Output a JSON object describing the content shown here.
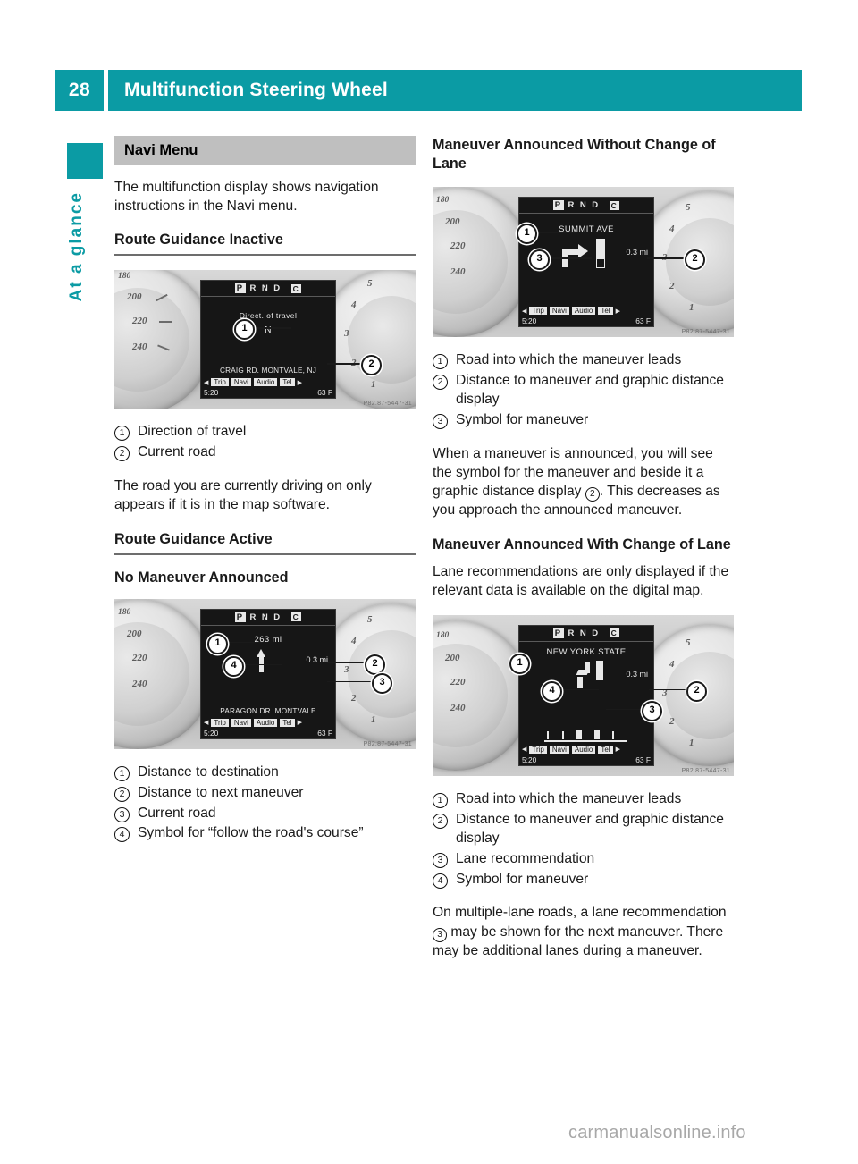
{
  "header": {
    "page_number": "28",
    "title": "Multifunction Steering Wheel",
    "accent_color": "#0b9ba4"
  },
  "side_tab": {
    "label": "At a glance"
  },
  "left_column": {
    "banner": "Navi Menu",
    "intro": "The multifunction display shows navigation instructions in the Navi menu.",
    "section_inactive": "Route Guidance Inactive",
    "figure_inactive": {
      "prnd": [
        "P",
        "R",
        "N",
        "D"
      ],
      "gear_indicator": "C",
      "line1": "Direct. of travel",
      "line2": "N",
      "road": "CRAIG RD. MONTVALE, NJ",
      "menu": [
        "Trip",
        "Navi",
        "Audio",
        "Tel"
      ],
      "selected_menu": "Navi",
      "time": "5:20",
      "temperature": "63 F",
      "photo_id": "P82.87-5447-31",
      "callouts": [
        "1",
        "2"
      ],
      "speedo_numbers": [
        "180",
        "200",
        "220",
        "240"
      ],
      "tacho_numbers": [
        "1",
        "2",
        "3",
        "4",
        "5"
      ]
    },
    "legend_inactive": [
      {
        "num": "1",
        "text": "Direction of travel"
      },
      {
        "num": "2",
        "text": "Current road"
      }
    ],
    "note_inactive": "The road you are currently driving on only appears if it is in the map software.",
    "section_active": "Route Guidance Active",
    "subsection_no_maneuver": "No Maneuver Announced",
    "figure_no_maneuver": {
      "prnd": [
        "P",
        "R",
        "N",
        "D"
      ],
      "gear_indicator": "C",
      "distance_to_destination": "263 mi",
      "distance_to_maneuver": "0.3 mi",
      "road": "PARAGON DR. MONTVALE",
      "menu": [
        "Trip",
        "Navi",
        "Audio",
        "Tel"
      ],
      "selected_menu": "Navi",
      "time": "5:20",
      "temperature": "63 F",
      "photo_id": "P82.87-5447-31",
      "callouts": [
        "1",
        "2",
        "3",
        "4"
      ]
    },
    "legend_no_maneuver": [
      {
        "num": "1",
        "text": "Distance to destination"
      },
      {
        "num": "2",
        "text": "Distance to next maneuver"
      },
      {
        "num": "3",
        "text": "Current road"
      },
      {
        "num": "4",
        "text": "Symbol for “follow the road's course”"
      }
    ]
  },
  "right_column": {
    "section_without_lane": "Maneuver Announced Without Change of Lane",
    "figure_without_lane": {
      "prnd": [
        "P",
        "R",
        "N",
        "D"
      ],
      "gear_indicator": "C",
      "road_into": "SUMMIT AVE",
      "distance_to_maneuver": "0.3 mi",
      "menu": [
        "Trip",
        "Navi",
        "Audio",
        "Tel"
      ],
      "selected_menu": "Navi",
      "time": "5:20",
      "temperature": "63 F",
      "photo_id": "P82.87-5447-31",
      "callouts": [
        "1",
        "2",
        "3"
      ]
    },
    "legend_without_lane": [
      {
        "num": "1",
        "text": "Road into which the maneuver leads"
      },
      {
        "num": "2",
        "text": "Distance to maneuver and graphic distance display"
      },
      {
        "num": "3",
        "text": "Symbol for maneuver"
      }
    ],
    "note_without_lane_a": "When a maneuver is announced, you will see the symbol for the maneuver and beside it a graphic distance display ",
    "note_without_lane_ref": "2",
    "note_without_lane_b": ". This decreases as you approach the announced maneuver.",
    "section_with_lane": "Maneuver Announced With Change of Lane",
    "note_with_lane_intro": "Lane recommendations are only displayed if the relevant data is available on the digital map.",
    "figure_with_lane": {
      "prnd": [
        "P",
        "R",
        "N",
        "D"
      ],
      "gear_indicator": "C",
      "road_into": "NEW YORK STATE",
      "distance_to_maneuver": "0.3 mi",
      "menu": [
        "Trip",
        "Navi",
        "Audio",
        "Tel"
      ],
      "selected_menu": "Navi",
      "time": "5:20",
      "temperature": "63 F",
      "photo_id": "P82.87-5447-31",
      "callouts": [
        "1",
        "2",
        "3",
        "4"
      ]
    },
    "legend_with_lane": [
      {
        "num": "1",
        "text": "Road into which the maneuver leads"
      },
      {
        "num": "2",
        "text": "Distance to maneuver and graphic distance display"
      },
      {
        "num": "3",
        "text": "Lane recommendation"
      },
      {
        "num": "4",
        "text": "Symbol for maneuver"
      }
    ],
    "note_with_lane_a": "On multiple-lane roads, a lane recommendation ",
    "note_with_lane_ref": "3",
    "note_with_lane_b": " may be shown for the next maneuver. There may be additional lanes during a maneuver."
  },
  "footer": {
    "watermark": "carmanualsonline.info"
  }
}
